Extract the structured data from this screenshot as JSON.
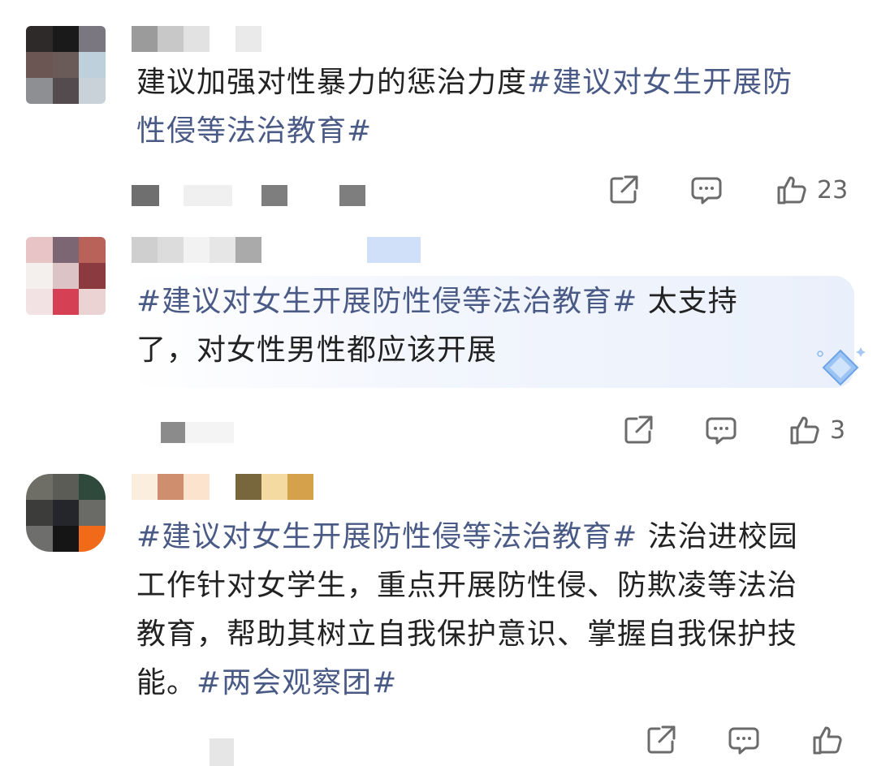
{
  "comments": [
    {
      "text": "建议加强对性暴力的惩治力度",
      "topics": [
        "#建议对女生开展防性侵等法治教育#"
      ],
      "line2_topic": "性侵等法治教育#",
      "line1_topic": "#建议对女生开展防",
      "like_count": "23"
    },
    {
      "line1_topic": "#建议对女生开展防性侵等法治教育#",
      "line1_text": " 太支持",
      "line2_text": "了，对女性男性都应该开展",
      "like_count": "3"
    },
    {
      "line1_topic": "#建议对女生开展防性侵等法治教育#",
      "line1_text": " 法治进校园",
      "line2_text": "工作针对女学生，重点开展防性侵、防欺凌等法治",
      "line3_text": "教育，帮助其树立自我保护意识、掌握自我保护技",
      "line4_text": "能。",
      "line4_topic": "#两会观察团#",
      "like_count": ""
    }
  ],
  "icons": {
    "share": "share-icon",
    "comment": "comment-icon",
    "like": "thumbs-up-icon"
  },
  "colors": {
    "topic": "#4a5a86",
    "text": "#222222",
    "icon": "#6b6b6b"
  }
}
